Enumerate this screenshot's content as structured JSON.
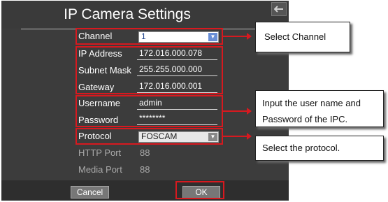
{
  "dialog": {
    "title": "IP Camera Settings",
    "back_icon": "back-arrow-icon"
  },
  "fields": {
    "channel": {
      "label": "Channel",
      "value": "1"
    },
    "ip_address": {
      "label": "IP Address",
      "value": "172.016.000.078"
    },
    "subnet_mask": {
      "label": "Subnet Mask",
      "value": "255.255.000.000"
    },
    "gateway": {
      "label": "Gateway",
      "value": "172.016.000.001"
    },
    "username": {
      "label": "Username",
      "value": "admin"
    },
    "password": {
      "label": "Password",
      "value": "********"
    },
    "protocol": {
      "label": "Protocol",
      "value": "FOSCAM"
    },
    "http_port": {
      "label": "HTTP Port",
      "value": "88"
    },
    "media_port": {
      "label": "Media Port",
      "value": "88"
    }
  },
  "buttons": {
    "cancel": "Cancel",
    "ok": "OK"
  },
  "callouts": {
    "channel": "Select Channel",
    "credentials": "Input the user name and Password of the IPC.",
    "protocol": "Select the protocol."
  },
  "colors": {
    "annotation": "#d7191f",
    "panel": "#3c3c3c",
    "dropdown_accent": "#6a8fd6"
  }
}
